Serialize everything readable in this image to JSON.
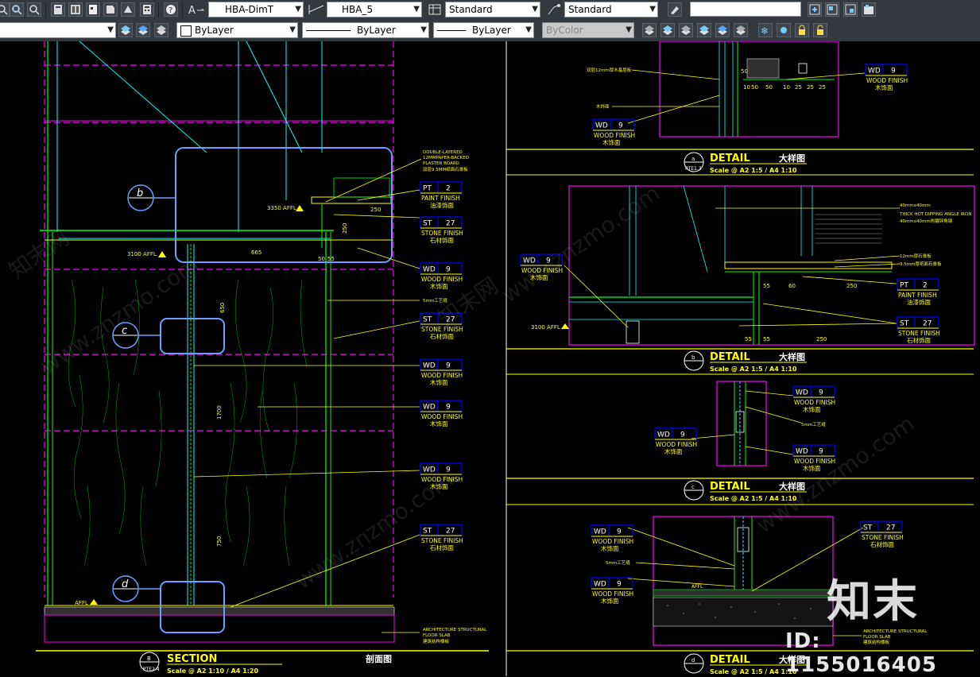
{
  "toolbar1": {
    "dimstyle": "HBA-DimT",
    "mleaderstyle": "HBA_5",
    "tablestyle": "Standard",
    "textstyle": "Standard",
    "search_value": ""
  },
  "toolbar2": {
    "layer_value": "",
    "color": "ByLayer",
    "linetype": "ByLayer",
    "lineweight": "ByLayer",
    "plotstyle": "ByColor"
  },
  "colors": {
    "background": "#000000",
    "magenta": "#ff00ff",
    "yellow": "#ffff00",
    "cyan": "#00ffff",
    "green": "#00ff00",
    "blue": "#0000ff",
    "white": "#ffffff",
    "callout_blue": "#6aa0ff"
  },
  "drawing": {
    "section": {
      "title": "SECTION",
      "title_cn": "剖面图",
      "num": "B",
      "ref": "PTE2.4",
      "scale": "Scale @ A2 1:10 / A4 1:20",
      "callouts": [
        "b",
        "c",
        "d"
      ],
      "dims": [
        "3350 AFFL",
        "3100 AFFL",
        "665",
        "250",
        "250",
        "50",
        "55",
        "650",
        "1700",
        "750",
        "AFFL"
      ],
      "labels": [
        {
          "code": "PT",
          "num": "2",
          "en": "PAINT FINISH",
          "cn": "油漆饰面"
        },
        {
          "code": "ST",
          "num": "27",
          "en": "STONE FINISH",
          "cn": "石材饰面"
        },
        {
          "code": "WD",
          "num": "9",
          "en": "WOOD FINISH",
          "cn": "木饰面"
        },
        {
          "code": "ST",
          "num": "27",
          "en": "STONE FINISH",
          "cn": "石材饰面"
        },
        {
          "code": "WD",
          "num": "9",
          "en": "WOOD FINISH",
          "cn": "木饰面"
        },
        {
          "code": "WD",
          "num": "9",
          "en": "WOOD FINISH",
          "cn": "木饰面"
        },
        {
          "code": "WD",
          "num": "9",
          "en": "WOOD FINISH",
          "cn": "木饰面"
        },
        {
          "code": "ST",
          "num": "27",
          "en": "STONE FINISH",
          "cn": "石材饰面"
        }
      ],
      "note_top": [
        "DOUBLE-LAYERED",
        "12MMPAPER-BACKED",
        "PLASTER BOARD",
        "双层9.5MM纸面石膏板"
      ],
      "note_mid": "5mm工艺缝",
      "note_bottom": [
        "ARCHITECTURE STRUCTURAL",
        "FLOOR SLAB",
        "建筑结构楼板"
      ]
    },
    "details": [
      {
        "title": "DETAIL",
        "title_cn": "大样图",
        "num": "a",
        "ref": "PTE1.3",
        "scale": "Scale @ A2 1:5 / A4 1:10",
        "labels": [
          {
            "code": "WD",
            "num": "9",
            "en": "WOOD FINISH",
            "cn": "木饰面"
          },
          {
            "code": "WD",
            "num": "9",
            "en": "WOOD FINISH",
            "cn": "木饰面"
          }
        ],
        "dims": [
          "50",
          "10",
          "50",
          "50",
          "10",
          "25",
          "25",
          "25"
        ],
        "notes": [
          "双层12mm厚木基层板",
          "木饰面"
        ]
      },
      {
        "title": "DETAIL",
        "title_cn": "大样图",
        "num": "b",
        "ref": "-",
        "scale": "Scale @ A2 1:5 / A4 1:10",
        "labels": [
          {
            "code": "WD",
            "num": "9",
            "en": "WOOD FINISH",
            "cn": "木饰面"
          },
          {
            "code": "PT",
            "num": "2",
            "en": "PAINT FINISH",
            "cn": "油漆饰面"
          },
          {
            "code": "ST",
            "num": "27",
            "en": "STONE FINISH",
            "cn": "石材饰面"
          }
        ],
        "dims": [
          "55",
          "60",
          "250",
          "55",
          "55",
          "250",
          "3100 AFFL"
        ],
        "notes": [
          "40mmx40mm",
          "THICK HOT DIPPING ANGLE IRON",
          "40mmx40mm热镀锌角钢",
          "12mm厚石膏板",
          "9.5mm厚纸面石膏板"
        ]
      },
      {
        "title": "DETAIL",
        "title_cn": "大样图",
        "num": "c",
        "ref": "-",
        "scale": "Scale @ A2 1:5 / A4 1:10",
        "labels": [
          {
            "code": "WD",
            "num": "9",
            "en": "WOOD FINISH",
            "cn": "木饰面"
          },
          {
            "code": "WD",
            "num": "9",
            "en": "WOOD FINISH",
            "cn": "木饰面"
          },
          {
            "code": "WD",
            "num": "9",
            "en": "WOOD FINISH",
            "cn": "木饰面"
          }
        ],
        "notes": [
          "5mm工艺缝"
        ]
      },
      {
        "title": "DETAIL",
        "title_cn": "大样图",
        "num": "d",
        "ref": "-",
        "scale": "Scale @ A2 1:5 / A4 1:10",
        "labels": [
          {
            "code": "WD",
            "num": "9",
            "en": "WOOD FINISH",
            "cn": "木饰面"
          },
          {
            "code": "WD",
            "num": "9",
            "en": "WOOD FINISH",
            "cn": "木饰面"
          },
          {
            "code": "ST",
            "num": "27",
            "en": "STONE FINISH",
            "cn": "石材饰面"
          }
        ],
        "notes": [
          "5mm工艺缝",
          "ARCHITECTURE STRUCTURAL",
          "FLOOR SLAB",
          "建筑结构楼板",
          "AFFL"
        ]
      }
    ]
  },
  "watermark": {
    "logo_text": "知末",
    "id_text": "ID: 1155016405",
    "site": "www.znzmo.com",
    "site_cn": "知末网"
  }
}
